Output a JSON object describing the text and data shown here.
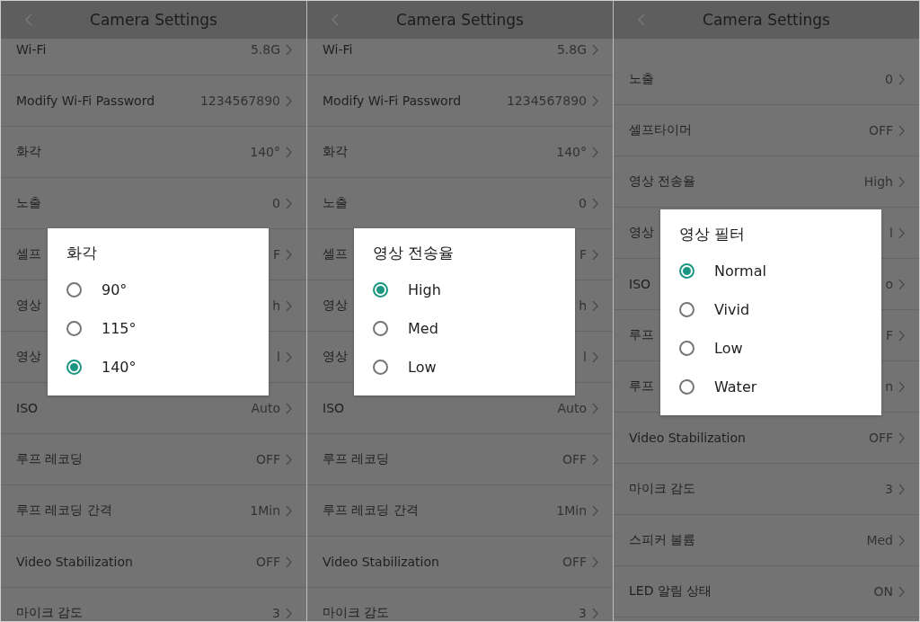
{
  "screens": [
    {
      "title": "Camera Settings",
      "rows": [
        {
          "label": "Wi-Fi",
          "value": "5.8G"
        },
        {
          "label": "Modify Wi-Fi Password",
          "value": "1234567890"
        },
        {
          "label": "화각",
          "value": "140°"
        },
        {
          "label": "노출",
          "value": "0"
        },
        {
          "label": "셀프",
          "value": "F"
        },
        {
          "label": "영상",
          "value": "h"
        },
        {
          "label": "영상",
          "value": "l"
        },
        {
          "label": "ISO",
          "value": "Auto"
        },
        {
          "label": "루프 레코딩",
          "value": "OFF"
        },
        {
          "label": "루프 레코딩 간격",
          "value": "1Min"
        },
        {
          "label": "Video Stabilization",
          "value": "OFF"
        },
        {
          "label": "마이크 감도",
          "value": "3"
        }
      ],
      "dialog": {
        "title": "화각",
        "options": [
          {
            "label": "90°",
            "selected": false
          },
          {
            "label": "115°",
            "selected": false
          },
          {
            "label": "140°",
            "selected": true
          }
        ]
      }
    },
    {
      "title": "Camera Settings",
      "rows": [
        {
          "label": "Wi-Fi",
          "value": "5.8G"
        },
        {
          "label": "Modify Wi-Fi Password",
          "value": "1234567890"
        },
        {
          "label": "화각",
          "value": "140°"
        },
        {
          "label": "노출",
          "value": "0"
        },
        {
          "label": "셀프",
          "value": "F"
        },
        {
          "label": "영상",
          "value": "h"
        },
        {
          "label": "영상",
          "value": "l"
        },
        {
          "label": "ISO",
          "value": "Auto"
        },
        {
          "label": "루프 레코딩",
          "value": "OFF"
        },
        {
          "label": "루프 레코딩 간격",
          "value": "1Min"
        },
        {
          "label": "Video Stabilization",
          "value": "OFF"
        },
        {
          "label": "마이크 감도",
          "value": "3"
        }
      ],
      "dialog": {
        "title": "영상 전송율",
        "options": [
          {
            "label": "High",
            "selected": true
          },
          {
            "label": "Med",
            "selected": false
          },
          {
            "label": "Low",
            "selected": false
          }
        ]
      }
    },
    {
      "title": "Camera Settings",
      "rows": [
        {
          "label": "노출",
          "value": "0"
        },
        {
          "label": "셀프타이머",
          "value": "OFF"
        },
        {
          "label": "영상 전송율",
          "value": "High"
        },
        {
          "label": "영상",
          "value": "l"
        },
        {
          "label": "ISO",
          "value": "o"
        },
        {
          "label": "루프",
          "value": "F"
        },
        {
          "label": "루프",
          "value": "n"
        },
        {
          "label": "Video Stabilization",
          "value": "OFF"
        },
        {
          "label": "마이크 감도",
          "value": "3"
        },
        {
          "label": "스피커 볼륨",
          "value": "Med"
        },
        {
          "label": "LED 알림 상태",
          "value": "ON"
        }
      ],
      "dialog": {
        "title": "영상 필터",
        "options": [
          {
            "label": "Normal",
            "selected": true
          },
          {
            "label": "Vivid",
            "selected": false
          },
          {
            "label": "Low",
            "selected": false
          },
          {
            "label": "Water",
            "selected": false
          }
        ]
      }
    }
  ]
}
